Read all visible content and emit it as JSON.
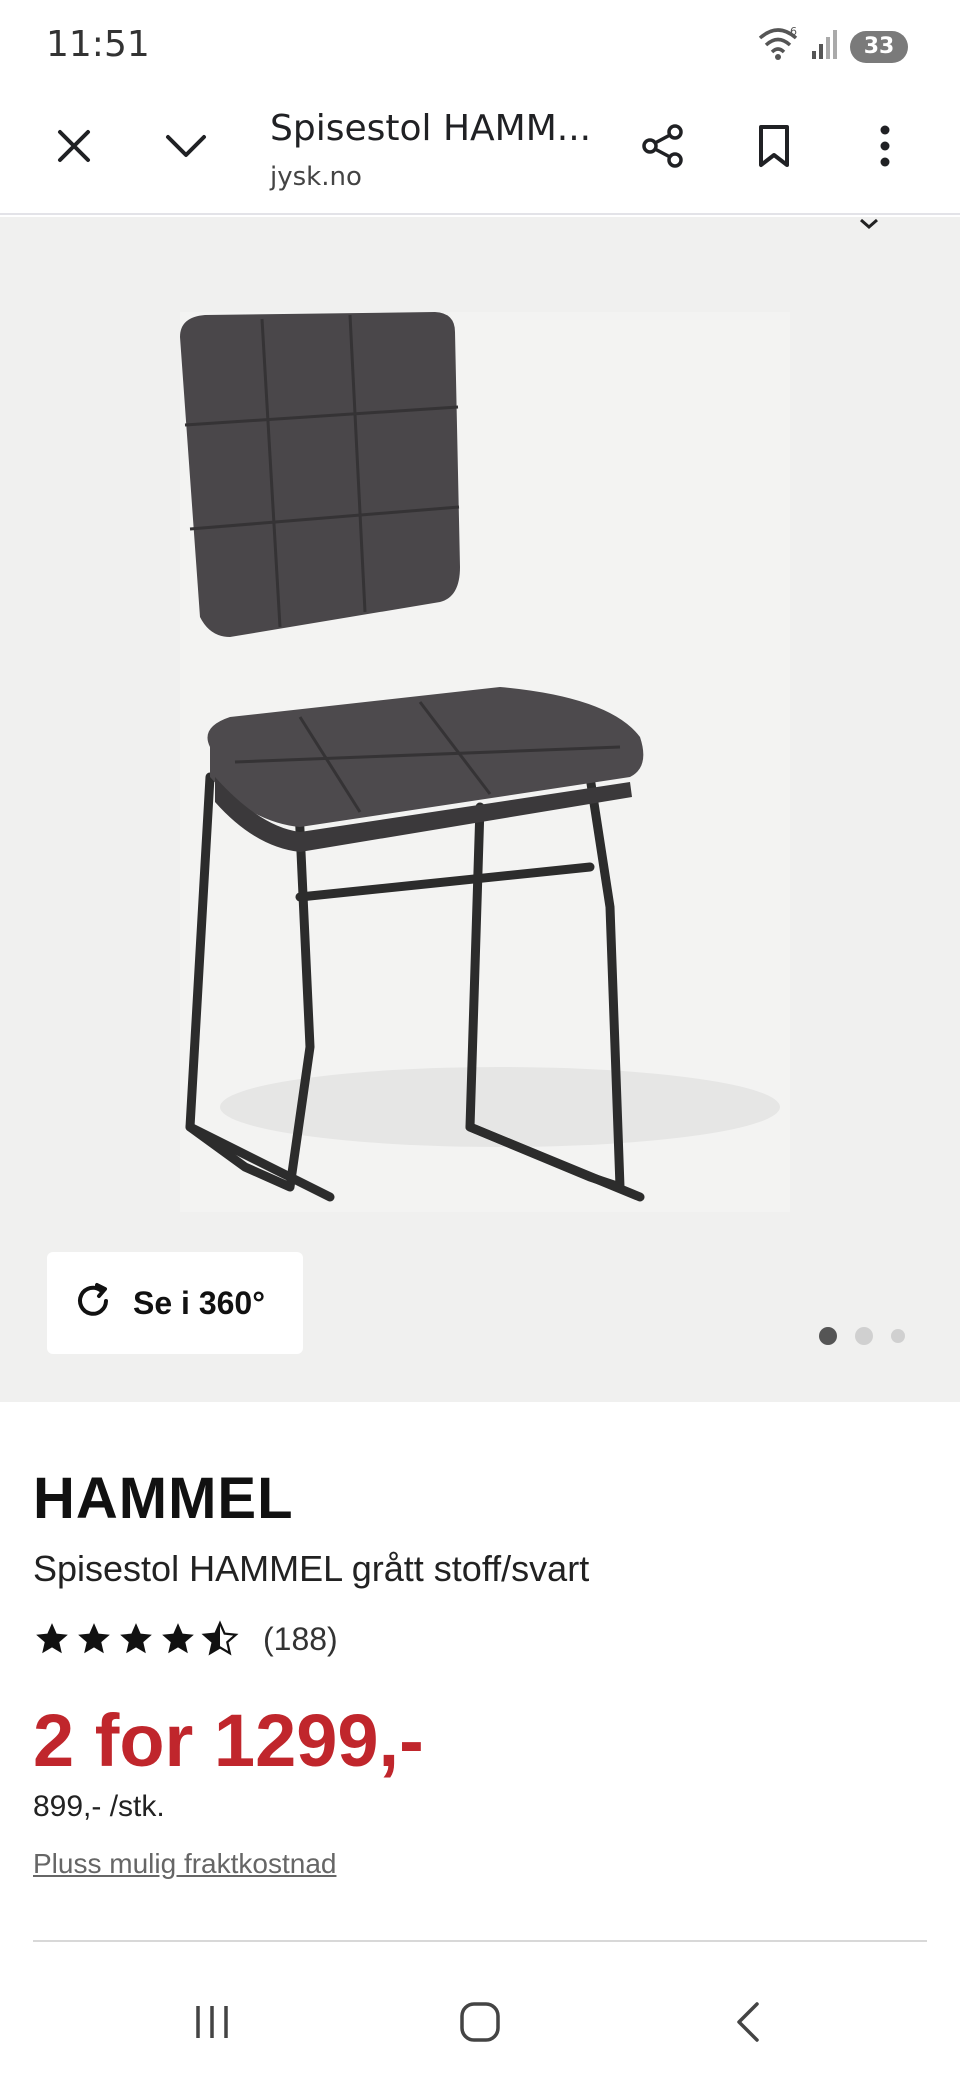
{
  "status_bar": {
    "time": "11:51",
    "wifi_badge": "6",
    "battery": "33",
    "icons": [
      "wifi-icon",
      "signal-icon",
      "battery-icon"
    ]
  },
  "browser": {
    "page_title": "Spisestol HAMM...",
    "domain": "jysk.no",
    "icons": [
      "close-icon",
      "chevron-down-icon",
      "share-icon",
      "bookmark-icon",
      "more-vert-icon"
    ]
  },
  "gallery": {
    "view_360_label": "Se i 360°",
    "image_count": 3,
    "active_index": 0
  },
  "product": {
    "brand": "HAMMEL",
    "name": "Spisestol HAMMEL grått stoff/svart",
    "rating": 4.5,
    "rating_max": 5,
    "review_count": "(188)",
    "price": "2 for 1299,-",
    "unit_price": "899,- /stk.",
    "shipping_link": "Pluss mulig fraktkostnad"
  },
  "colors": {
    "price_red": "#c0262c",
    "gallery_bg": "#f0f0ef",
    "star": "#111111"
  },
  "nav": {
    "icons": [
      "recent-apps-icon",
      "home-icon",
      "back-icon"
    ]
  }
}
